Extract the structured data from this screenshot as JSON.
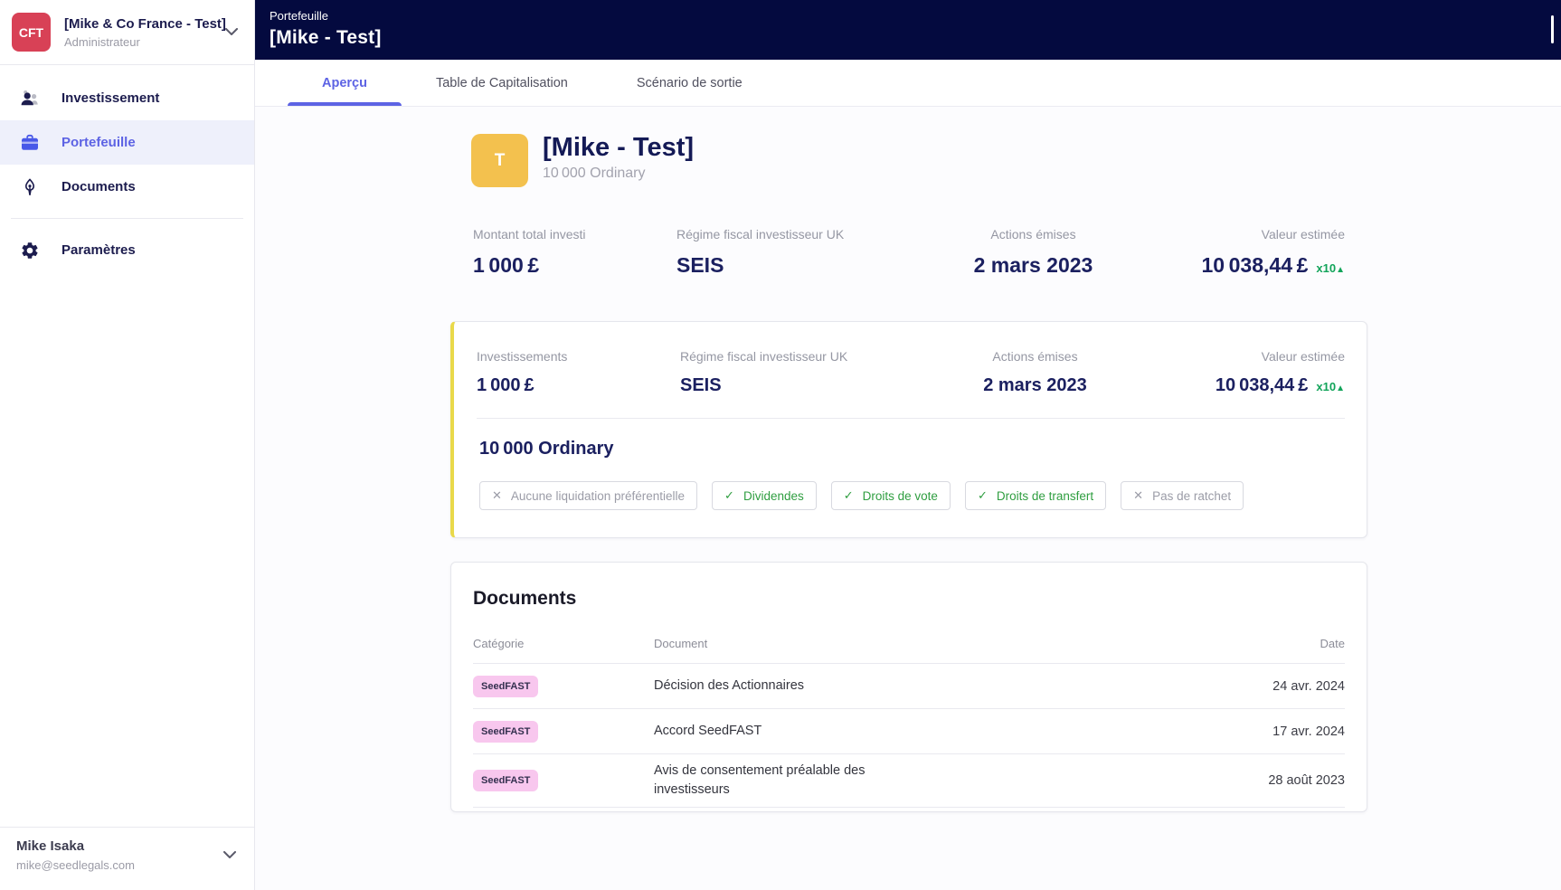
{
  "sidebar": {
    "company": {
      "initials": "CFT",
      "name": "[Mike & Co France - Test]",
      "role": "Administrateur"
    },
    "nav": {
      "investissement": "Investissement",
      "portefeuille": "Portefeuille",
      "documents": "Documents",
      "parametres": "Paramètres"
    },
    "user": {
      "name": "Mike Isaka",
      "email": "mike@seedlegals.com"
    }
  },
  "header": {
    "breadcrumb": "Portefeuille",
    "title": "[Mike - Test]"
  },
  "tabs": {
    "apercu": "Aperçu",
    "cap_table": "Table de Capitalisation",
    "exit": "Scénario de sortie"
  },
  "overview": {
    "avatar_letter": "T",
    "title": "[Mike - Test]",
    "subtitle": "10 000 Ordinary",
    "stats": [
      {
        "label": "Montant total investi",
        "value": "1 000 £"
      },
      {
        "label": "Régime fiscal investisseur UK",
        "value": "SEIS"
      },
      {
        "label": "Actions émises",
        "value": "2 mars 2023"
      },
      {
        "label": "Valeur estimée",
        "value": "10 038,44 £",
        "badge": "x10",
        "badge_arrow": "▲"
      }
    ]
  },
  "share_card": {
    "stats": [
      {
        "label": "Investissements",
        "value": "1 000 £"
      },
      {
        "label": "Régime fiscal investisseur UK",
        "value": "SEIS"
      },
      {
        "label": "Actions émises",
        "value": "2 mars 2023"
      },
      {
        "label": "Valeur estimée",
        "value": "10 038,44 £",
        "badge": "x10",
        "badge_arrow": "▲"
      }
    ],
    "share_class": "10 000 Ordinary",
    "tags": [
      {
        "label": "Aucune liquidation préférentielle",
        "glyph": "✕",
        "state": "no"
      },
      {
        "label": "Dividendes",
        "glyph": "✓",
        "state": "yes"
      },
      {
        "label": "Droits de vote",
        "glyph": "✓",
        "state": "yes"
      },
      {
        "label": "Droits de transfert",
        "glyph": "✓",
        "state": "yes"
      },
      {
        "label": "Pas de ratchet",
        "glyph": "✕",
        "state": "no"
      }
    ]
  },
  "documents_card": {
    "title": "Documents",
    "columns": {
      "category": "Catégorie",
      "document": "Document",
      "date": "Date"
    },
    "rows": [
      {
        "category": "SeedFAST",
        "document": "Décision des Actionnaires",
        "date": "24 avr. 2024"
      },
      {
        "category": "SeedFAST",
        "document": "Accord SeedFAST",
        "date": "17 avr. 2024"
      },
      {
        "category": "SeedFAST",
        "document": "Avis de consentement préalable des investisseurs",
        "date": "28 août 2023"
      }
    ]
  },
  "colors": {
    "accent": "#5d63e4",
    "header_bg": "#040a3f",
    "logo_bg": "#d84156",
    "avatar_bg": "#f3c14e",
    "positive_green": "#12a45a",
    "tag_green": "#2f9e40",
    "badge_pink": "#f8c7ee",
    "card_accent_border": "#e9d94a"
  }
}
